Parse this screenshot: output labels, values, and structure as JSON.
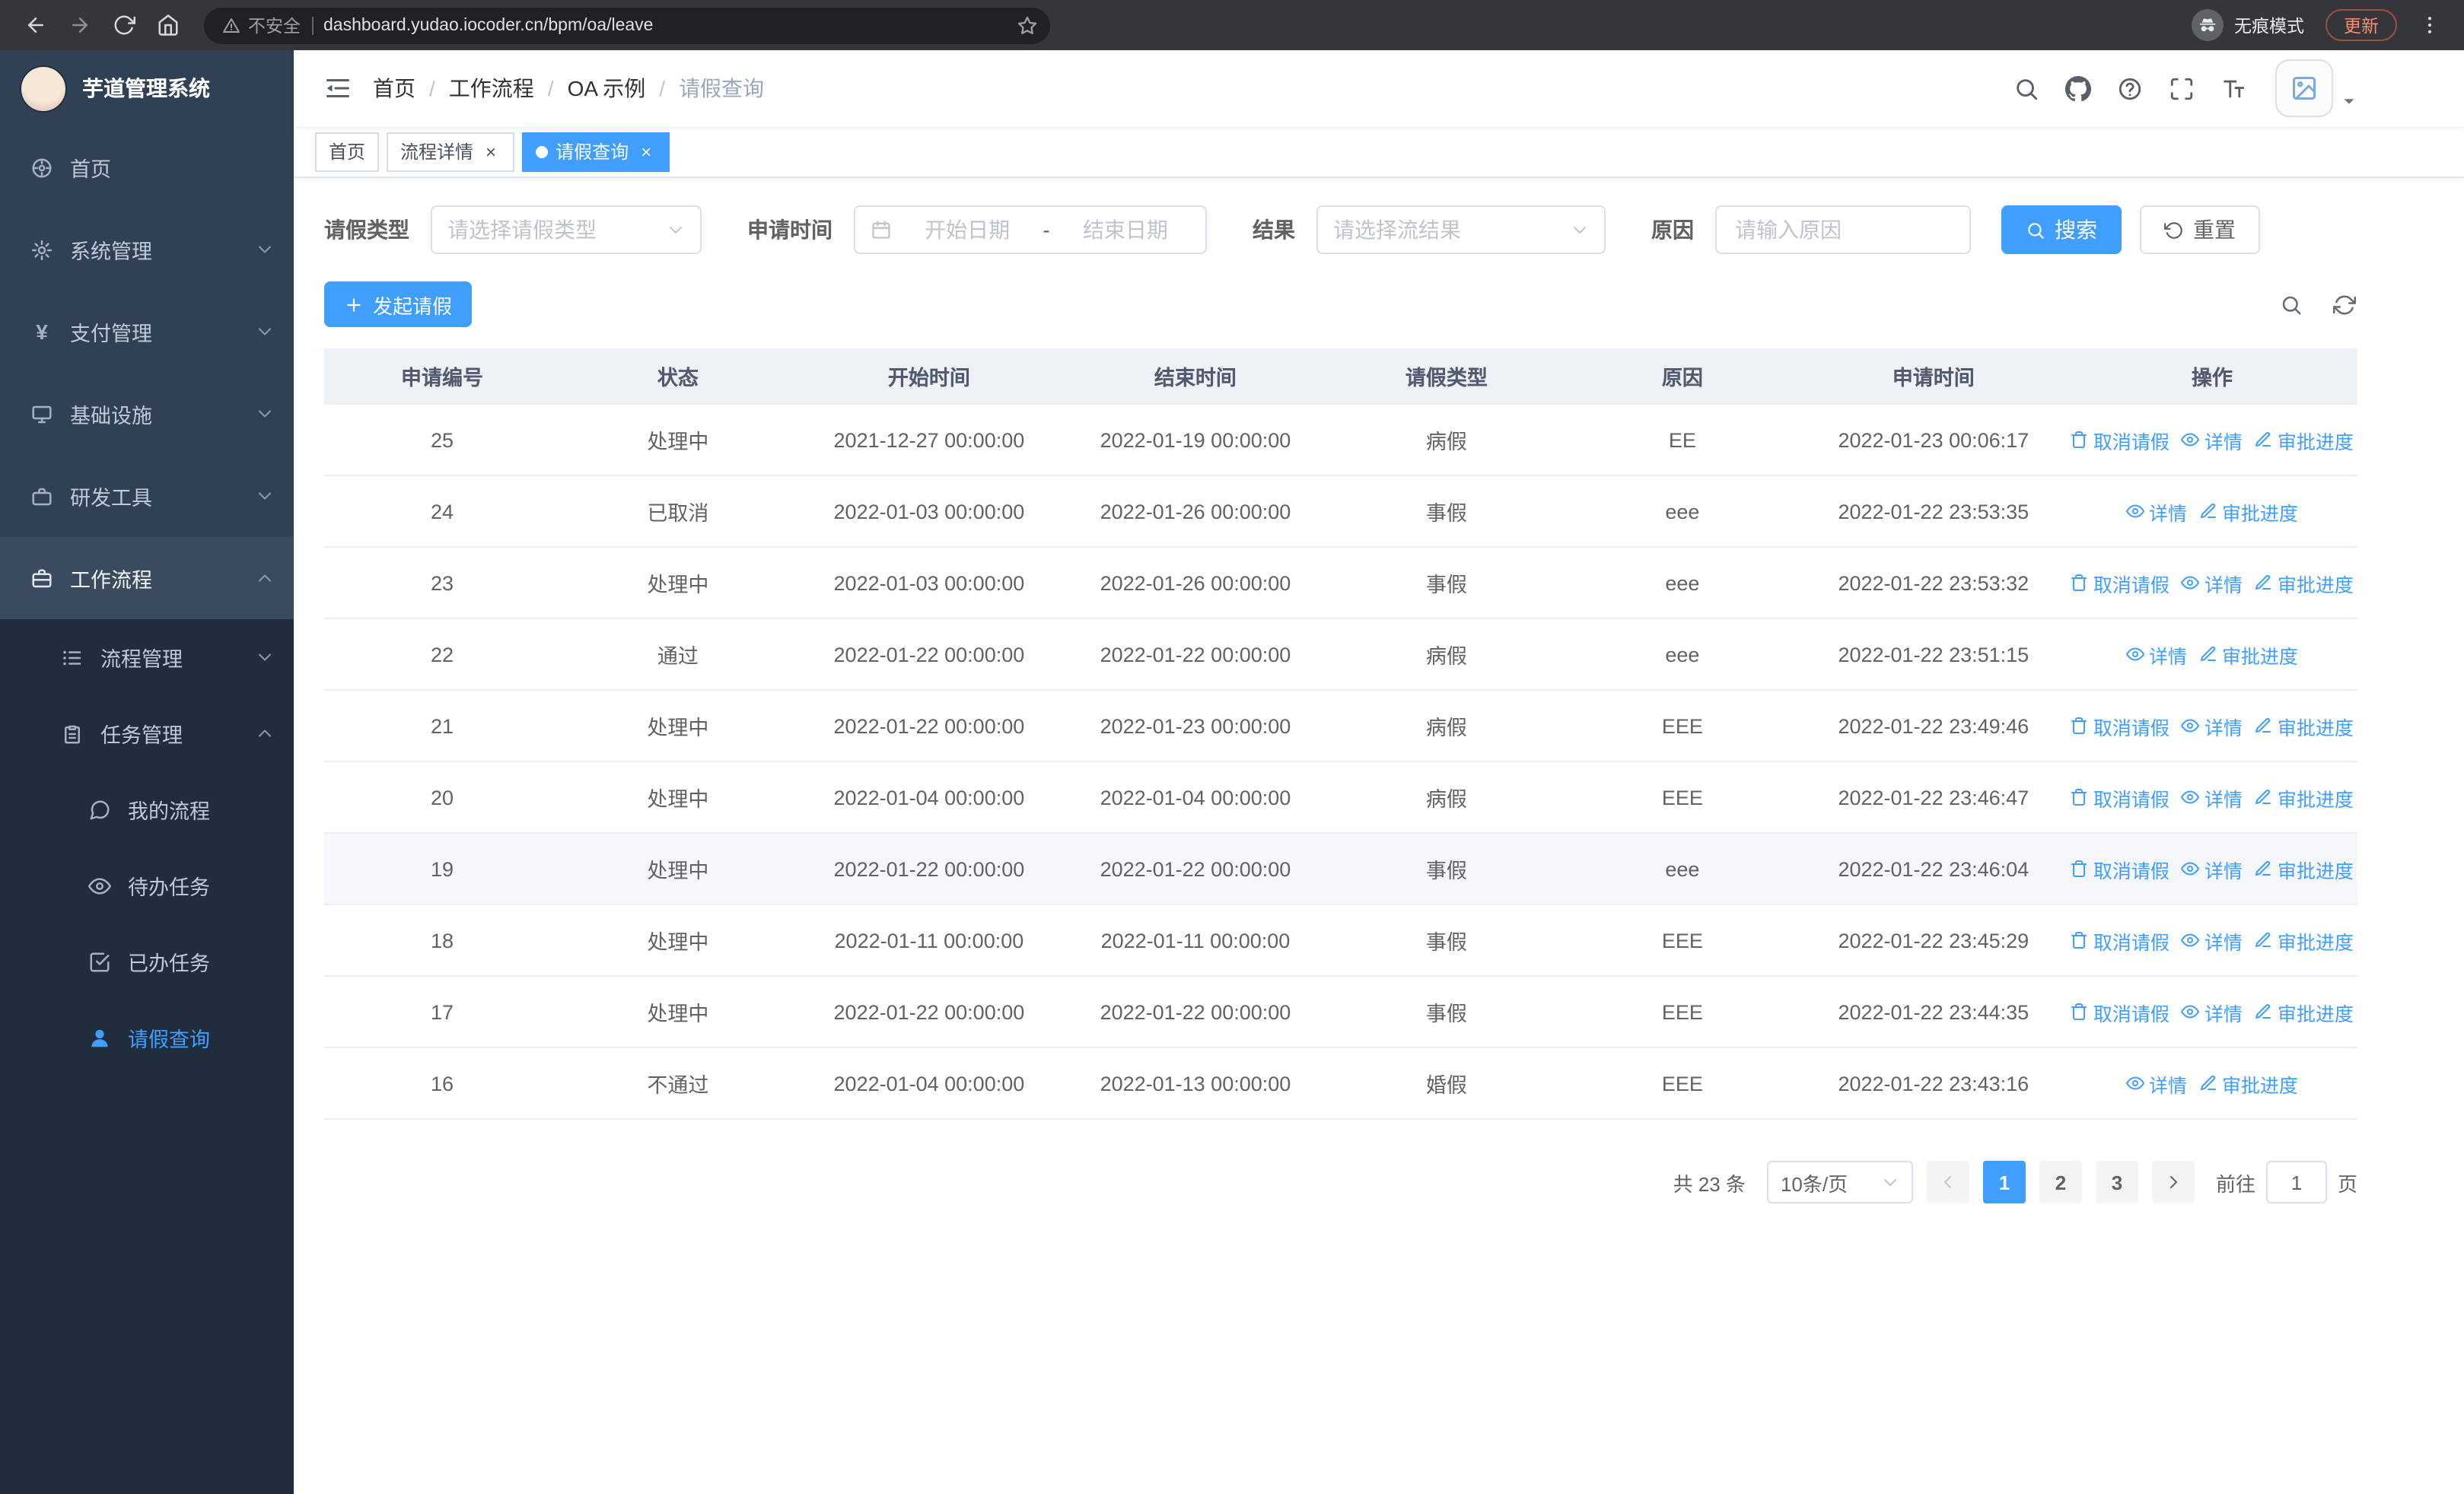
{
  "browser": {
    "security_label": "不安全",
    "url": "dashboard.yudao.iocoder.cn/bpm/oa/leave",
    "incognito_label": "无痕模式",
    "update_label": "更新"
  },
  "sidebar": {
    "logo_title": "芋道管理系统",
    "items": [
      {
        "label": "首页",
        "icon": "dashboard-icon"
      },
      {
        "label": "系统管理",
        "icon": "gear-icon"
      },
      {
        "label": "支付管理",
        "icon": "payment-icon",
        "icon_char": "¥"
      },
      {
        "label": "基础设施",
        "icon": "infrastructure-icon"
      },
      {
        "label": "研发工具",
        "icon": "devtools-icon"
      },
      {
        "label": "工作流程",
        "icon": "workflow-icon",
        "expanded": true
      }
    ],
    "workflow_children": [
      {
        "label": "流程管理",
        "icon": "process-icon"
      },
      {
        "label": "任务管理",
        "icon": "task-icon",
        "expanded": true
      }
    ],
    "task_children": [
      {
        "label": "我的流程",
        "icon": "chat-icon"
      },
      {
        "label": "待办任务",
        "icon": "eye-icon"
      },
      {
        "label": "已办任务",
        "icon": "done-icon"
      },
      {
        "label": "请假查询",
        "icon": "user-icon",
        "active": true
      }
    ]
  },
  "navbar": {
    "breadcrumb": [
      "首页",
      "工作流程",
      "OA 示例",
      "请假查询"
    ]
  },
  "tabs": [
    {
      "label": "首页",
      "closable": false,
      "active": false
    },
    {
      "label": "流程详情",
      "closable": true,
      "active": false
    },
    {
      "label": "请假查询",
      "closable": true,
      "active": true
    }
  ],
  "filters": {
    "leave_type_label": "请假类型",
    "leave_type_placeholder": "请选择请假类型",
    "apply_time_label": "申请时间",
    "start_placeholder": "开始日期",
    "range_separator": "-",
    "end_placeholder": "结束日期",
    "result_label": "结果",
    "result_placeholder": "请选择流结果",
    "reason_label": "原因",
    "reason_placeholder": "请输入原因",
    "search_label": "搜索",
    "reset_label": "重置"
  },
  "toolbar": {
    "create_label": "发起请假"
  },
  "table": {
    "columns": [
      "申请编号",
      "状态",
      "开始时间",
      "结束时间",
      "请假类型",
      "原因",
      "申请时间",
      "操作"
    ],
    "actions": {
      "cancel": "取消请假",
      "detail": "详情",
      "progress": "审批进度"
    },
    "rows": [
      {
        "no": "25",
        "status": "处理中",
        "start": "2021-12-27 00:00:00",
        "end": "2022-01-19 00:00:00",
        "type": "病假",
        "reason": "EE",
        "applied": "2022-01-23 00:06:17",
        "can_cancel": true,
        "highlighted": false
      },
      {
        "no": "24",
        "status": "已取消",
        "start": "2022-01-03 00:00:00",
        "end": "2022-01-26 00:00:00",
        "type": "事假",
        "reason": "eee",
        "applied": "2022-01-22 23:53:35",
        "can_cancel": false,
        "highlighted": false
      },
      {
        "no": "23",
        "status": "处理中",
        "start": "2022-01-03 00:00:00",
        "end": "2022-01-26 00:00:00",
        "type": "事假",
        "reason": "eee",
        "applied": "2022-01-22 23:53:32",
        "can_cancel": true,
        "highlighted": false
      },
      {
        "no": "22",
        "status": "通过",
        "start": "2022-01-22 00:00:00",
        "end": "2022-01-22 00:00:00",
        "type": "病假",
        "reason": "eee",
        "applied": "2022-01-22 23:51:15",
        "can_cancel": false,
        "highlighted": false
      },
      {
        "no": "21",
        "status": "处理中",
        "start": "2022-01-22 00:00:00",
        "end": "2022-01-23 00:00:00",
        "type": "病假",
        "reason": "EEE",
        "applied": "2022-01-22 23:49:46",
        "can_cancel": true,
        "highlighted": false
      },
      {
        "no": "20",
        "status": "处理中",
        "start": "2022-01-04 00:00:00",
        "end": "2022-01-04 00:00:00",
        "type": "病假",
        "reason": "EEE",
        "applied": "2022-01-22 23:46:47",
        "can_cancel": true,
        "highlighted": false
      },
      {
        "no": "19",
        "status": "处理中",
        "start": "2022-01-22 00:00:00",
        "end": "2022-01-22 00:00:00",
        "type": "事假",
        "reason": "eee",
        "applied": "2022-01-22 23:46:04",
        "can_cancel": true,
        "highlighted": true
      },
      {
        "no": "18",
        "status": "处理中",
        "start": "2022-01-11 00:00:00",
        "end": "2022-01-11 00:00:00",
        "type": "事假",
        "reason": "EEE",
        "applied": "2022-01-22 23:45:29",
        "can_cancel": true,
        "highlighted": false
      },
      {
        "no": "17",
        "status": "处理中",
        "start": "2022-01-22 00:00:00",
        "end": "2022-01-22 00:00:00",
        "type": "事假",
        "reason": "EEE",
        "applied": "2022-01-22 23:44:35",
        "can_cancel": true,
        "highlighted": false
      },
      {
        "no": "16",
        "status": "不通过",
        "start": "2022-01-04 00:00:00",
        "end": "2022-01-13 00:00:00",
        "type": "婚假",
        "reason": "EEE",
        "applied": "2022-01-22 23:43:16",
        "can_cancel": false,
        "highlighted": false
      }
    ]
  },
  "pagination": {
    "total": "共 23 条",
    "page_size": "10条/页",
    "pages": [
      "1",
      "2",
      "3"
    ],
    "active_page": "1",
    "goto_label": "前往",
    "goto_value": "1",
    "unit_label": "页"
  },
  "colors": {
    "primary": "#409eff",
    "sidebar_bg": "#304156",
    "sidebar_sub_bg": "#1f2d3d",
    "sidebar_text": "#bfcbd9"
  }
}
